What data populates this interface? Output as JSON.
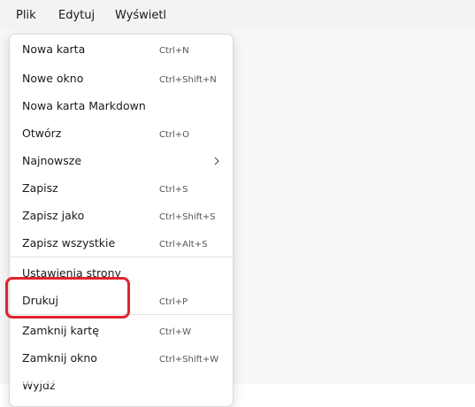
{
  "menubar": {
    "items": [
      "Plik",
      "Edytuj",
      "Wyświetl"
    ]
  },
  "menu": {
    "items": [
      {
        "label": "Nowa karta",
        "shortcut": "Ctrl+N"
      },
      {
        "label": "Nowe okno",
        "shortcut": "Ctrl+Shift+N"
      },
      {
        "label": "Nowa karta Markdown",
        "shortcut": ""
      },
      {
        "label": "Otwórz",
        "shortcut": "Ctrl+O"
      },
      {
        "label": "Najnowsze",
        "shortcut": ""
      },
      {
        "label": "Zapisz",
        "shortcut": "Ctrl+S"
      },
      {
        "label": "Zapisz jako",
        "shortcut": "Ctrl+Shift+S"
      },
      {
        "label": "Zapisz wszystkie",
        "shortcut": "Ctrl+Alt+S"
      },
      {
        "label": "Ustawienia strony",
        "shortcut": ""
      },
      {
        "label": "Drukuj",
        "shortcut": "Ctrl+P"
      },
      {
        "label": "Zamknij kartę",
        "shortcut": "Ctrl+W"
      },
      {
        "label": "Zamknij okno",
        "shortcut": "Ctrl+Shift+W"
      },
      {
        "label": "Wyjdź",
        "shortcut": ""
      }
    ]
  },
  "colors": {
    "highlight": "#e0232f",
    "menubar_bg": "#f3f3f3",
    "editor_bg": "#f7f7f7"
  }
}
